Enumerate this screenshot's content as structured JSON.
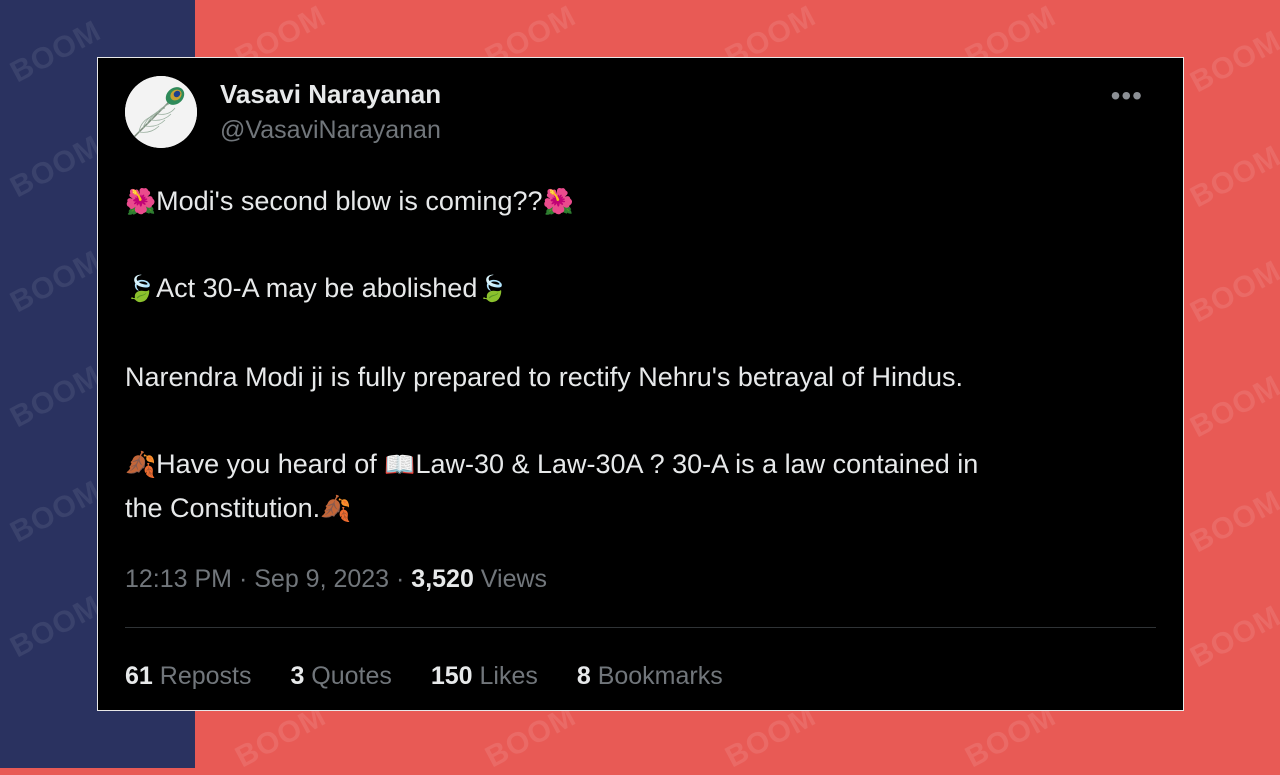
{
  "watermark": "BOOM",
  "user": {
    "name": "Vasavi Narayanan",
    "handle": "@VasaviNarayanan"
  },
  "more_label": "•••",
  "icons": {
    "avatar": "peacock-feather-icon",
    "more": "more-options-icon",
    "hibiscus": "hibiscus-emoji",
    "leaf": "leaf-fluttering-emoji",
    "fallen_leaf": "fallen-leaf-emoji",
    "book": "open-book-emoji"
  },
  "tweet": {
    "line1": "Modi's second blow is coming??",
    "line2": "Act 30-A may be abolished",
    "line3": "Narendra Modi ji is fully prepared to rectify Nehru's betrayal of Hindus.",
    "line4a": "Have you heard of ",
    "line4b": "Law-30 & Law-30A ? 30-A is a law contained in",
    "line5": "the Constitution."
  },
  "meta": {
    "time": "12:13 PM",
    "sep1": " · ",
    "date": "Sep 9, 2023",
    "sep2": " · ",
    "views_count": "3,520",
    "views_label": " Views"
  },
  "stats": {
    "reposts_count": "61",
    "reposts_label": " Reposts",
    "quotes_count": "3",
    "quotes_label": " Quotes",
    "likes_count": "150",
    "likes_label": " Likes",
    "bookmarks_count": "8",
    "bookmarks_label": " Bookmarks"
  },
  "colors": {
    "background_red": "#e85a55",
    "background_blue": "#2a3260",
    "card": "#000000",
    "text": "#e7e9ea",
    "muted": "#71767b"
  }
}
